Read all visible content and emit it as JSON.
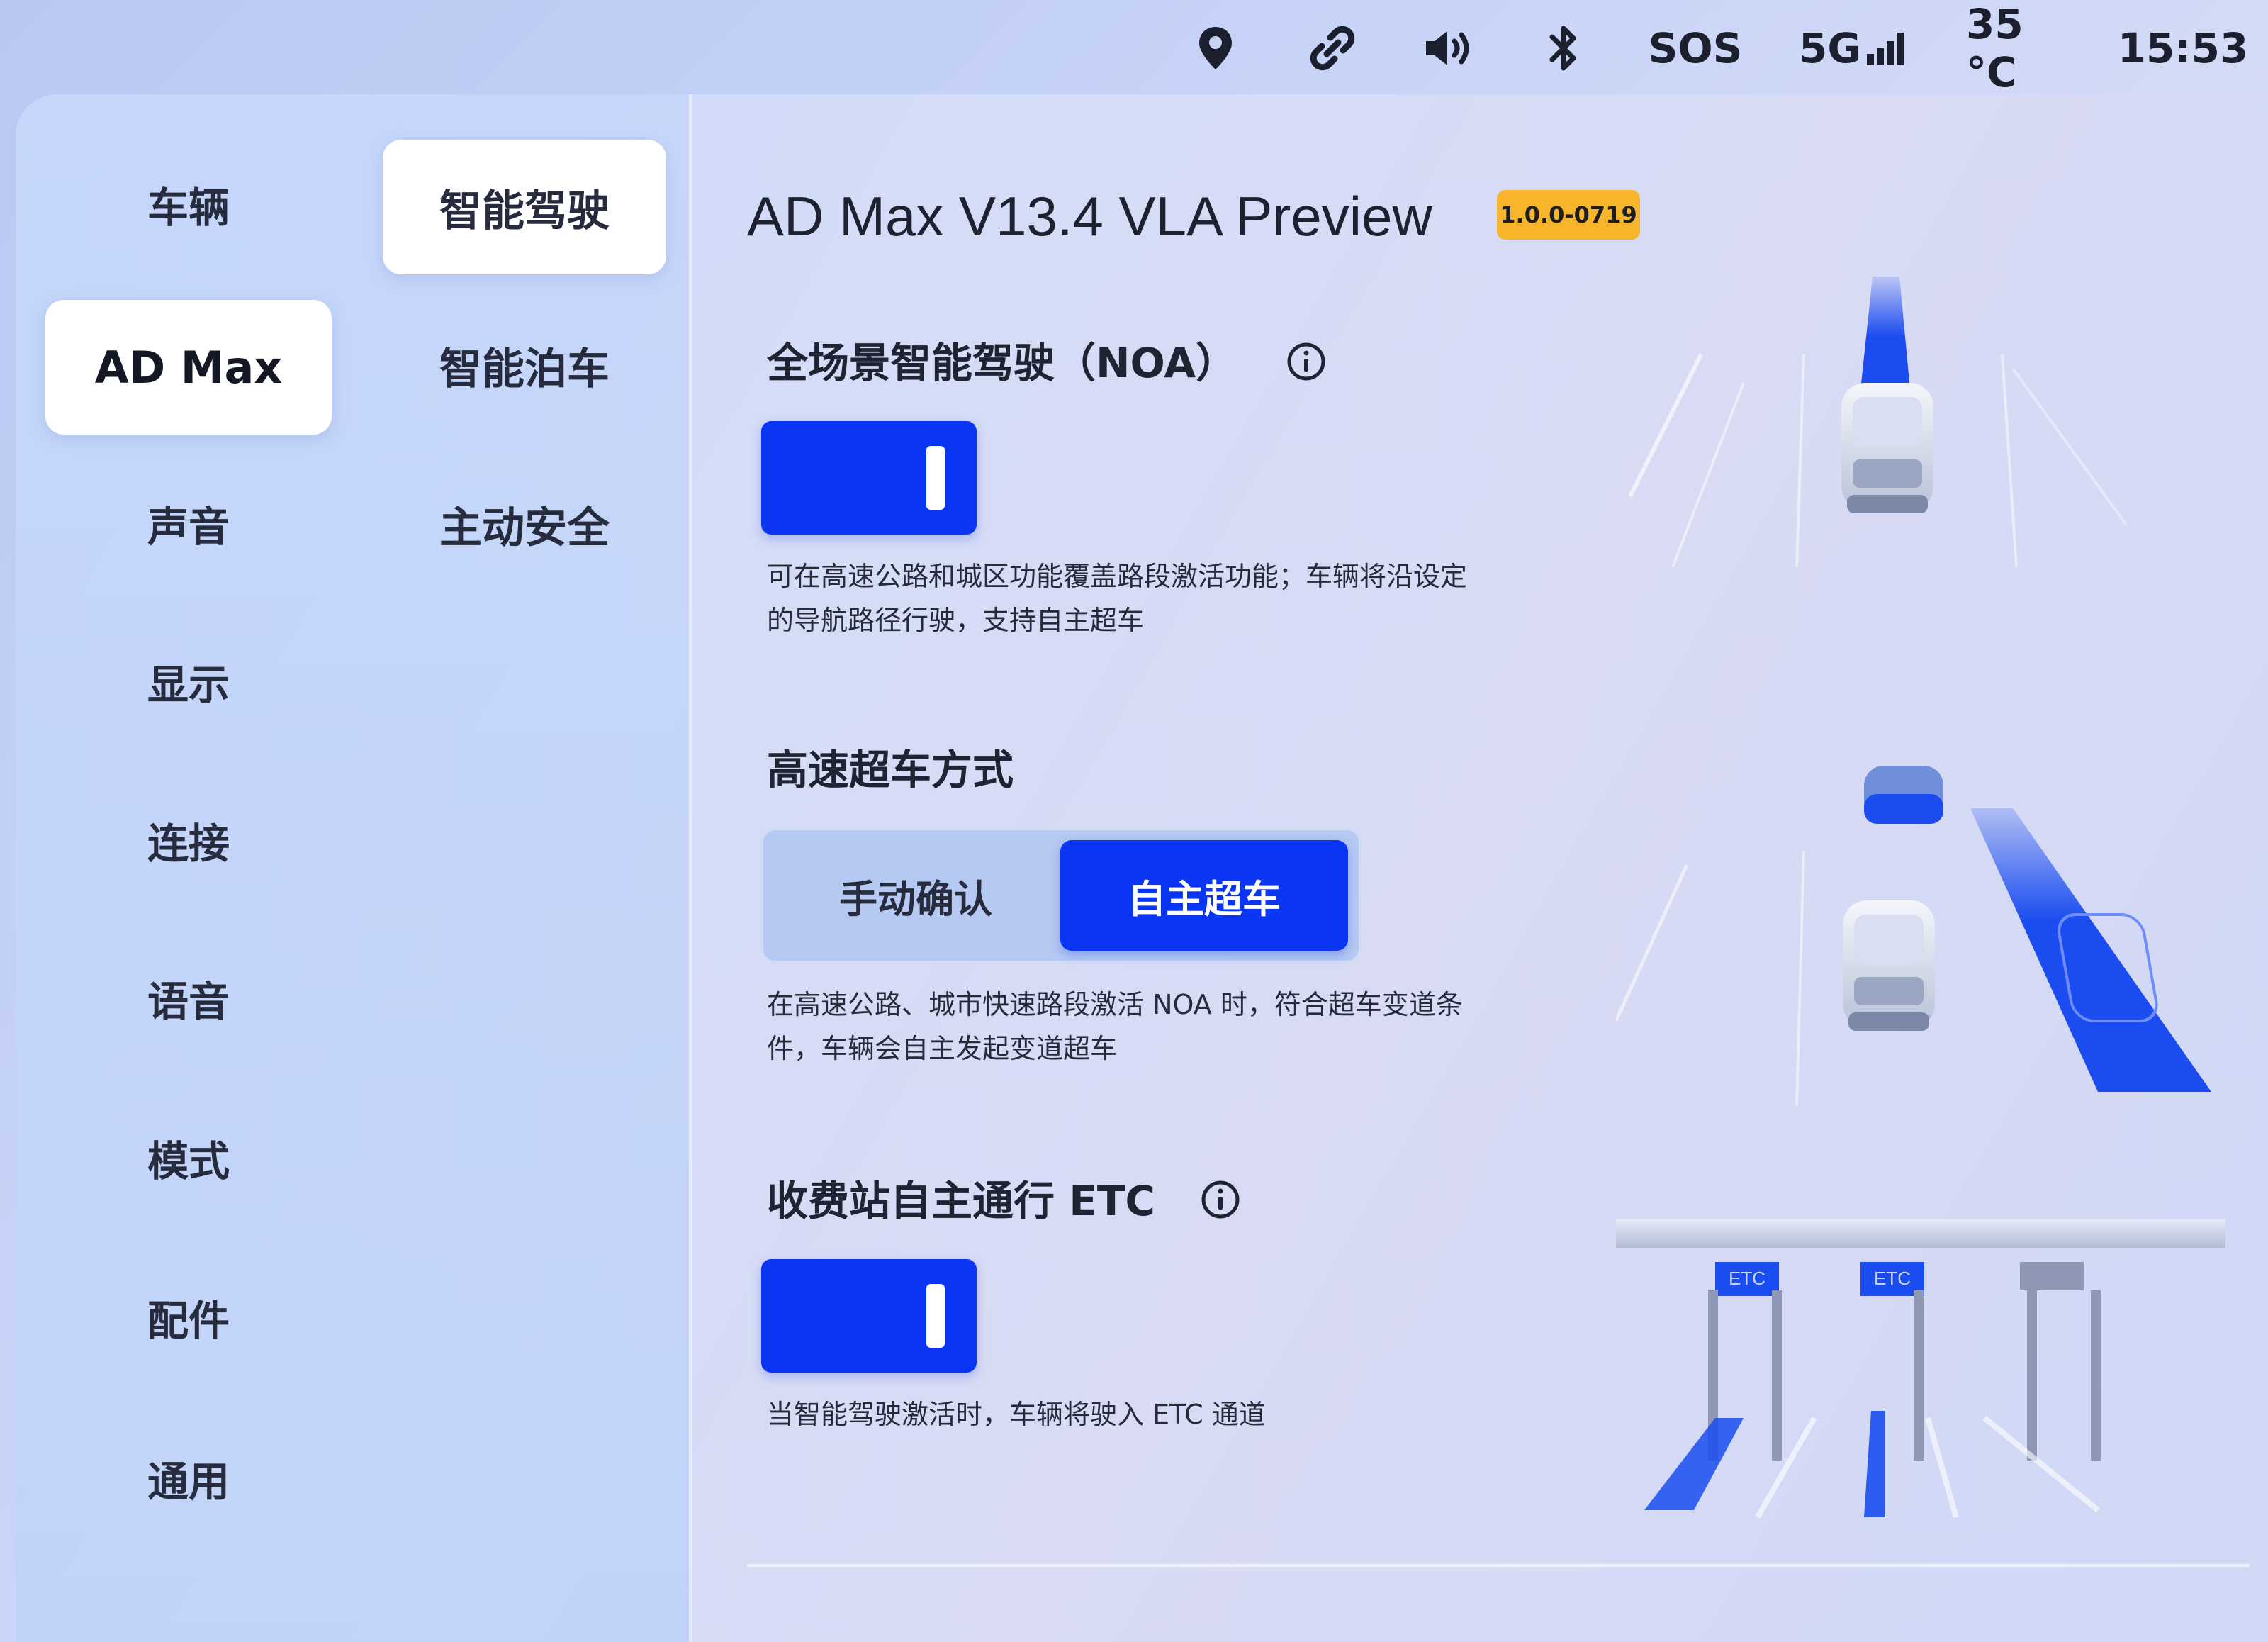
{
  "status_bar": {
    "icons": [
      "location-icon",
      "link-icon",
      "volume-icon",
      "bluetooth-icon",
      "signal-icon"
    ],
    "sos": "SOS",
    "network": "5G",
    "temperature": "35 °C",
    "time": "15:53"
  },
  "nav_primary": {
    "items": [
      {
        "label": "车辆"
      },
      {
        "label": "AD Max",
        "active": true
      },
      {
        "label": "声音"
      },
      {
        "label": "显示"
      },
      {
        "label": "连接"
      },
      {
        "label": "语音"
      },
      {
        "label": "模式"
      },
      {
        "label": "配件"
      },
      {
        "label": "通用"
      }
    ]
  },
  "nav_secondary": {
    "items": [
      {
        "label": "智能驾驶",
        "active": true
      },
      {
        "label": "智能泊车"
      },
      {
        "label": "主动安全"
      }
    ]
  },
  "content": {
    "title": "AD Max V13.4 VLA Preview",
    "version_badge": "1.0.0-0719",
    "noa": {
      "title": "全场景智能驾驶（NOA）",
      "enabled": true,
      "description": "可在高速公路和城区功能覆盖路段激活功能；车辆将沿设定的导航路径行驶，支持自主超车"
    },
    "overtake": {
      "title": "高速超车方式",
      "options": [
        "手动确认",
        "自主超车"
      ],
      "selected": "自主超车",
      "description": "在高速公路、城市快速路段激活 NOA 时，符合超车变道条件，车辆会自主发起变道超车"
    },
    "etc": {
      "title": "收费站自主通行 ETC",
      "enabled": true,
      "description": "当智能驾驶激活时，车辆将驶入 ETC 通道",
      "booth_labels": [
        "ETC",
        "ETC"
      ]
    }
  },
  "colors": {
    "accent": "#0a35f2",
    "badge": "#f6b52b",
    "text": "#1f2433"
  }
}
